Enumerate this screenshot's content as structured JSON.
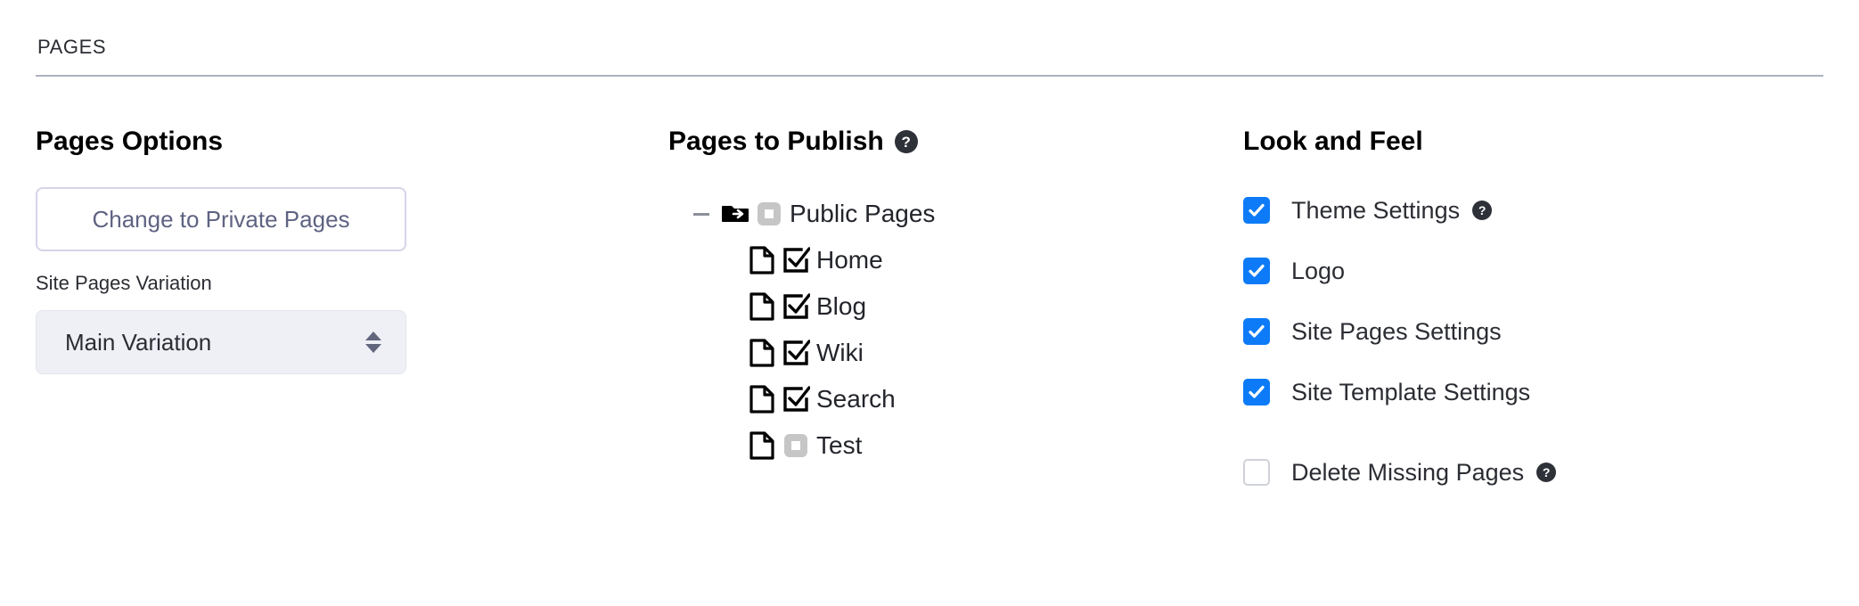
{
  "section": {
    "header": "PAGES"
  },
  "colors": {
    "accent_checkbox": "#0d7bf7",
    "help_badge": "#2f3138",
    "button_border": "#d6d4e8",
    "button_text": "#5f6382",
    "select_bg": "#eef0f5",
    "rule": "#aeb3c0",
    "tree_gray_box": "#c6c6c6"
  },
  "pages_options": {
    "title": "Pages Options",
    "change_button_label": "Change to Private Pages",
    "variation_label": "Site Pages Variation",
    "variation_value": "Main Variation",
    "variation_options": [
      "Main Variation"
    ],
    "stepper_up_icon": "triangle-up-icon",
    "stepper_down_icon": "triangle-down-icon"
  },
  "pages_to_publish": {
    "title": "Pages to Publish",
    "help_icon": "question-mark-icon",
    "help_label": "?",
    "root": {
      "label": "Public Pages",
      "toggle_icon": "collapse-minus-icon",
      "node_icon": "folder-arrow-icon",
      "check_state": "indeterminate"
    },
    "children": [
      {
        "label": "Home",
        "node_icon": "page-icon",
        "check_state": "checked"
      },
      {
        "label": "Blog",
        "node_icon": "page-icon",
        "check_state": "checked"
      },
      {
        "label": "Wiki",
        "node_icon": "page-icon",
        "check_state": "checked"
      },
      {
        "label": "Search",
        "node_icon": "page-icon",
        "check_state": "checked"
      },
      {
        "label": "Test",
        "node_icon": "page-icon",
        "check_state": "indeterminate"
      }
    ]
  },
  "look_and_feel": {
    "title": "Look and Feel",
    "help_label": "?",
    "items": [
      {
        "label": "Theme Settings",
        "checked": true,
        "help": true,
        "help_icon": "question-mark-icon"
      },
      {
        "label": "Logo",
        "checked": true,
        "help": false,
        "help_icon": ""
      },
      {
        "label": "Site Pages Settings",
        "checked": true,
        "help": false,
        "help_icon": ""
      },
      {
        "label": "Site Template Settings",
        "checked": true,
        "help": false,
        "help_icon": ""
      },
      {
        "label": "Delete Missing Pages",
        "checked": false,
        "help": true,
        "help_icon": "question-mark-icon"
      }
    ]
  }
}
